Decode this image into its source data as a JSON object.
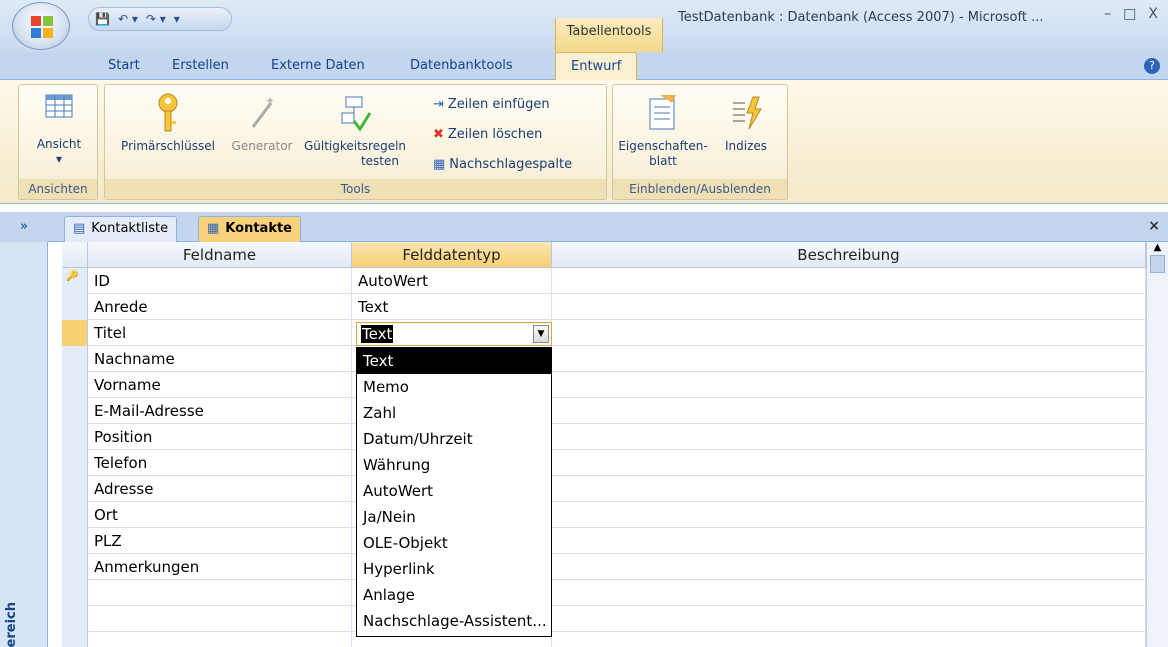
{
  "window": {
    "title": "TestDatenbank : Datenbank (Access 2007) - Microsoft ...",
    "context_tab": "Tabellentools",
    "controls": [
      "–",
      "□",
      "X"
    ]
  },
  "ribbon_tabs": [
    "Start",
    "Erstellen",
    "Externe Daten",
    "Datenbanktools",
    "Entwurf"
  ],
  "ribbon": {
    "ansichten": {
      "label": "Ansichten",
      "ansicht": "Ansicht"
    },
    "tools": {
      "label": "Tools",
      "primaerschluessel": "Primärschlüssel",
      "generator": "Generator",
      "gueltigkeit": [
        "Gültigkeitsregeln",
        "testen"
      ],
      "zeilen_einfuegen": "Zeilen einfügen",
      "zeilen_loeschen": "Zeilen löschen",
      "nachschlagespalte": "Nachschlagespalte"
    },
    "einblenden": {
      "label": "Einblenden/Ausblenden",
      "eigenschaften": [
        "Eigenschaften-",
        "blatt"
      ],
      "indizes": "Indizes"
    }
  },
  "nav": {
    "toggle": "»",
    "label": "ereich"
  },
  "doc_tabs": [
    "Kontaktliste",
    "Kontakte"
  ],
  "grid": {
    "headers": [
      "Feldname",
      "Felddatentyp",
      "Beschreibung"
    ],
    "rows": [
      {
        "name": "ID",
        "type": "AutoWert",
        "key": true
      },
      {
        "name": "Anrede",
        "type": "Text"
      },
      {
        "name": "Titel",
        "type": "Text"
      },
      {
        "name": "Nachname",
        "type": ""
      },
      {
        "name": "Vorname",
        "type": ""
      },
      {
        "name": "E-Mail-Adresse",
        "type": ""
      },
      {
        "name": "Position",
        "type": ""
      },
      {
        "name": "Telefon",
        "type": ""
      },
      {
        "name": "Adresse",
        "type": ""
      },
      {
        "name": "Ort",
        "type": ""
      },
      {
        "name": "PLZ",
        "type": ""
      },
      {
        "name": "Anmerkungen",
        "type": ""
      },
      {
        "name": "",
        "type": ""
      },
      {
        "name": "",
        "type": ""
      },
      {
        "name": "",
        "type": ""
      }
    ]
  },
  "combo": {
    "value": "Text"
  },
  "dropdown": [
    "Text",
    "Memo",
    "Zahl",
    "Datum/Uhrzeit",
    "Währung",
    "AutoWert",
    "Ja/Nein",
    "OLE-Objekt",
    "Hyperlink",
    "Anlage",
    "Nachschlage-Assistent..."
  ],
  "colors": {
    "accent": "#f8cf72",
    "ribbon_text": "#15428b"
  }
}
